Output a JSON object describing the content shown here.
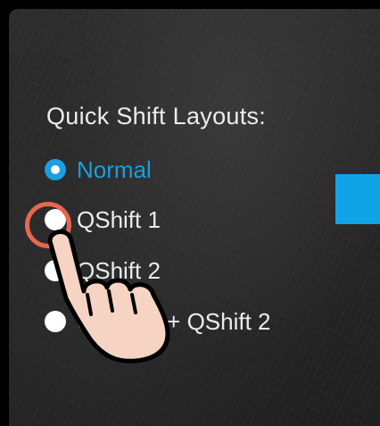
{
  "heading": "Quick Shift Layouts:",
  "options": [
    {
      "label": "Normal",
      "selected": true
    },
    {
      "label": "QShift 1",
      "selected": false
    },
    {
      "label": "QShift 2",
      "selected": false
    },
    {
      "label": "QShift 1 + QShift 2",
      "selected": false
    }
  ],
  "colors": {
    "accent": "#1a9fe0",
    "block": "#10a4e6",
    "tap_ring": "#e8664e",
    "hand_fill": "#f6d3c3"
  },
  "overlay": {
    "icon": "tapping-hand-icon",
    "ring": "tap-ring-indicator"
  }
}
